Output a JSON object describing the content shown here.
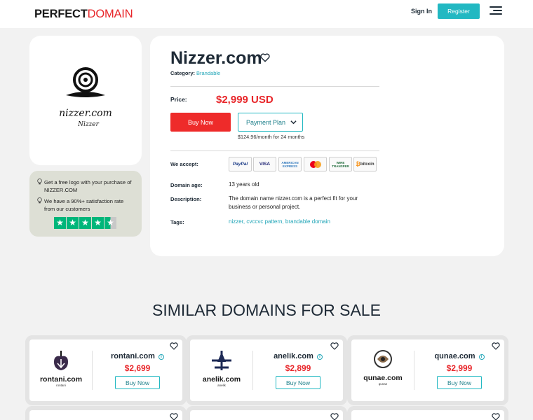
{
  "header": {
    "logo_bold": "PERFECT",
    "logo_light": "DOMAIN",
    "signin_label": "Sign In",
    "register_label": "Register"
  },
  "logo_card": {
    "script_text": "nizzer.com",
    "sub_text": "Nizzer"
  },
  "promo": {
    "line1": "Get a free logo with your purchase of NIZZER.COM",
    "line2": "We have a 90%+ satisfaction rate from our customers",
    "rating_stars": 4.5
  },
  "domain": {
    "name": "Nizzer.com",
    "category_label": "Category:",
    "category_value": "Brandable",
    "price_label": "Price:",
    "price_value": "$2,999 USD",
    "buy_label": "Buy Now",
    "plan_label": "Payment Plan",
    "plan_note": "$124.96/month for 24 months",
    "accept_label": "We accept:",
    "payment_methods": [
      "PayPal",
      "VISA",
      "AMERICAN EXPRESS",
      "Mastercard",
      "WIRE TRANSFER",
      "bitcoin"
    ],
    "age_label": "Domain age:",
    "age_value": "13 years old",
    "description_label": "Description:",
    "description_value": "The domain name nizzer.com is a perfect fit for your business or personal project.",
    "tags_label": "Tags:",
    "tags_value": "nizzer, cvccvc pattern, brandable domain"
  },
  "similar": {
    "title": "SIMILAR DOMAINS FOR SALE",
    "items": [
      {
        "name": "rontani.com",
        "price": "$2,699",
        "buy": "Buy Now",
        "logo_text": "rontani.com",
        "logo_sub": "rontani"
      },
      {
        "name": "anelik.com",
        "price": "$2,899",
        "buy": "Buy Now",
        "logo_text": "anelik.com",
        "logo_sub": "anelik"
      },
      {
        "name": "qunae.com",
        "price": "$2,999",
        "buy": "Buy Now",
        "logo_text": "qunae.com",
        "logo_sub": "qunae"
      }
    ]
  },
  "colors": {
    "accent_red": "#e8262a",
    "accent_teal": "#22b8c2",
    "trustpilot_green": "#00b67a"
  }
}
